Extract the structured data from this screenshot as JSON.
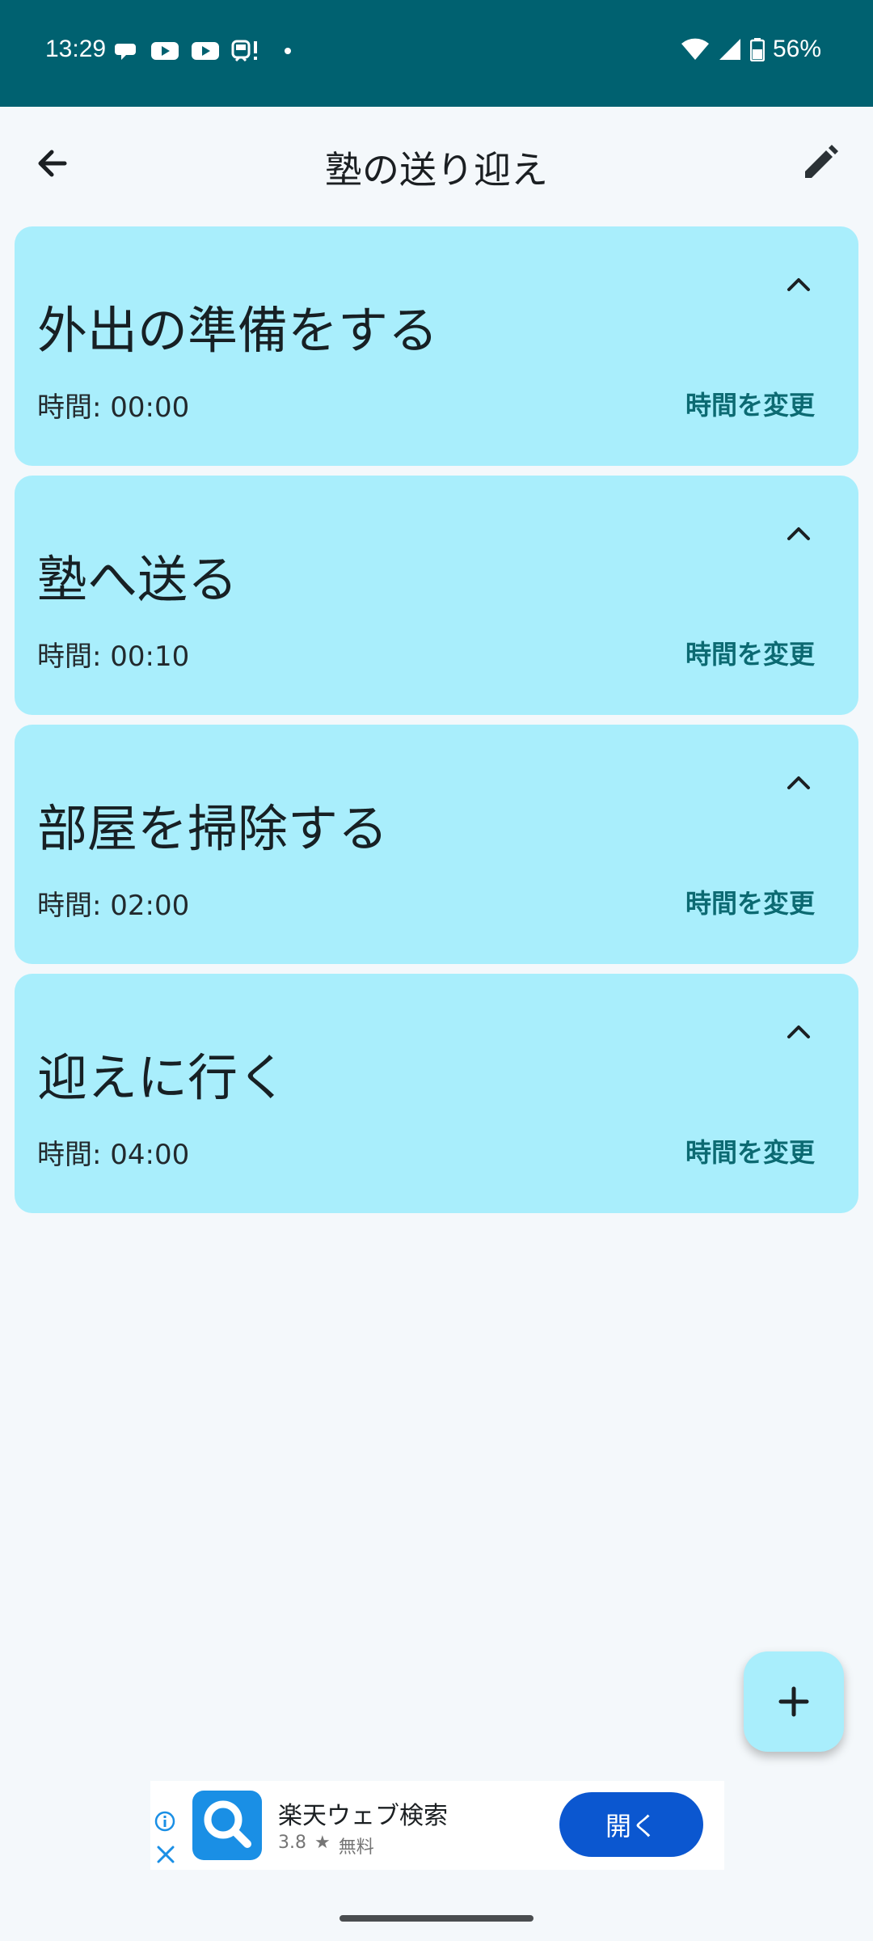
{
  "status_bar": {
    "time": "13:29",
    "battery": "56%",
    "left_icons": [
      "chat-icon",
      "youtube-icon",
      "youtube-icon",
      "train-alert-icon",
      "dot-icon"
    ],
    "right_icons": [
      "wifi-icon",
      "signal-icon",
      "battery-icon"
    ]
  },
  "appbar": {
    "title": "塾の送り迎え"
  },
  "tasks": [
    {
      "title": "外出の準備をする",
      "time": "時間: 00:00",
      "change_label": "時間を変更"
    },
    {
      "title": "塾へ送る",
      "time": "時間: 00:10",
      "change_label": "時間を変更"
    },
    {
      "title": "部屋を掃除する",
      "time": "時間: 02:00",
      "change_label": "時間を変更"
    },
    {
      "title": "迎えに行く",
      "time": "時間: 04:00",
      "change_label": "時間を変更"
    }
  ],
  "fab": {
    "icon": "plus-icon"
  },
  "ad": {
    "title": "楽天ウェブ検索",
    "rating": "3.8",
    "price": "無料",
    "button": "開く"
  },
  "colors": {
    "status_bar": "#006170",
    "card": "#a9eefc",
    "accent_text": "#0c6a72",
    "ad_button": "#0b57d0"
  }
}
